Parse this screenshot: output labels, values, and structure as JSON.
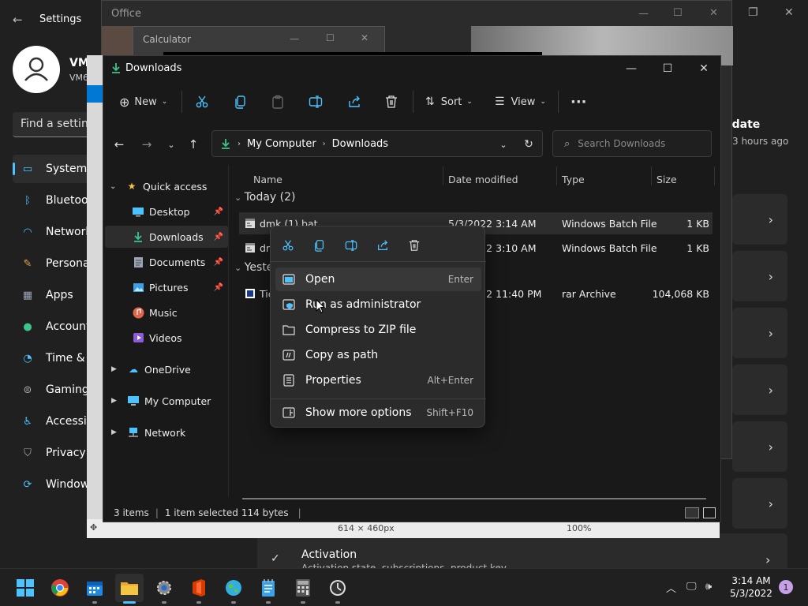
{
  "settings": {
    "title": "Settings",
    "account": {
      "name": "VMe",
      "sub": "VM6"
    },
    "search_placeholder": "Find a setting",
    "nav": [
      {
        "label": "System",
        "icon": "display-icon",
        "color": "#4cc2ff"
      },
      {
        "label": "Bluetoot",
        "icon": "bluetooth-icon",
        "color": "#4cc2ff"
      },
      {
        "label": "Network",
        "icon": "wifi-icon",
        "color": "#4cc2ff"
      },
      {
        "label": "Persona",
        "icon": "brush-icon",
        "color": "#e8a44a"
      },
      {
        "label": "Apps",
        "icon": "apps-icon",
        "color": "#9aa6b6"
      },
      {
        "label": "Account",
        "icon": "person-icon",
        "color": "#3cc48c"
      },
      {
        "label": "Time &",
        "icon": "clock-icon",
        "color": "#4cc2ff"
      },
      {
        "label": "Gaming",
        "icon": "gamepad-icon",
        "color": "#aaa"
      },
      {
        "label": "Accessib",
        "icon": "accessibility-icon",
        "color": "#4cc2ff"
      },
      {
        "label": "Privacy",
        "icon": "shield-icon",
        "color": "#aaa"
      },
      {
        "label": "Window",
        "icon": "update-icon",
        "color": "#4cc2ff"
      }
    ],
    "update": {
      "title": "odate",
      "sub": "3 hours ago"
    },
    "activation": {
      "title": "Activation",
      "sub": "Activation state, subscriptions, product key"
    }
  },
  "office": {
    "title": "Office"
  },
  "calculator": {
    "title": "Calculator"
  },
  "viewer": {
    "size": "614 × 460px",
    "zoom": "100%"
  },
  "explorer": {
    "title": "Downloads",
    "toolbar": {
      "new_label": "New",
      "sort_label": "Sort",
      "view_label": "View"
    },
    "address": {
      "root": "My Computer",
      "current": "Downloads"
    },
    "search_placeholder": "Search Downloads",
    "nav": {
      "quick_access": "Quick access",
      "items": [
        {
          "label": "Desktop",
          "pinned": true
        },
        {
          "label": "Downloads",
          "pinned": true,
          "selected": true
        },
        {
          "label": "Documents",
          "pinned": true
        },
        {
          "label": "Pictures",
          "pinned": true
        },
        {
          "label": "Music",
          "pinned": false
        },
        {
          "label": "Videos",
          "pinned": false
        }
      ],
      "onedrive": "OneDrive",
      "my_computer": "My Computer",
      "network": "Network"
    },
    "columns": [
      "Name",
      "Date modified",
      "Type",
      "Size"
    ],
    "groups": [
      {
        "label": "Today (2)",
        "files": [
          {
            "name": "dmk (1).bat",
            "date": "5/3/2022 3:14 AM",
            "type": "Windows Batch File",
            "size": "1 KB",
            "selected": true
          },
          {
            "name": "dmk.bat",
            "date": "5/3/2022 3:10 AM",
            "type": "Windows Batch File",
            "size": "1 KB"
          }
        ]
      },
      {
        "label": "Yesterday (1)",
        "files": [
          {
            "name": "Tie",
            "date": "5/2/2022 11:40 PM",
            "type": "rar Archive",
            "size": "104,068 KB"
          }
        ]
      }
    ],
    "status": {
      "items": "3 items",
      "selected": "1 item selected",
      "bytes": "114 bytes"
    }
  },
  "context_menu": {
    "items": [
      {
        "label": "Open",
        "shortcut": "Enter"
      },
      {
        "label": "Run as administrator",
        "shortcut": ""
      },
      {
        "label": "Compress to ZIP file",
        "shortcut": ""
      },
      {
        "label": "Copy as path",
        "shortcut": ""
      },
      {
        "label": "Properties",
        "shortcut": "Alt+Enter"
      },
      {
        "label": "Show more options",
        "shortcut": "Shift+F10"
      }
    ]
  },
  "taskbar": {
    "time": "3:14 AM",
    "date": "5/3/2022",
    "notifications": "1"
  },
  "colors": {
    "accent": "#4cc2ff",
    "folder": "#f4c542",
    "green": "#3cc48c"
  }
}
